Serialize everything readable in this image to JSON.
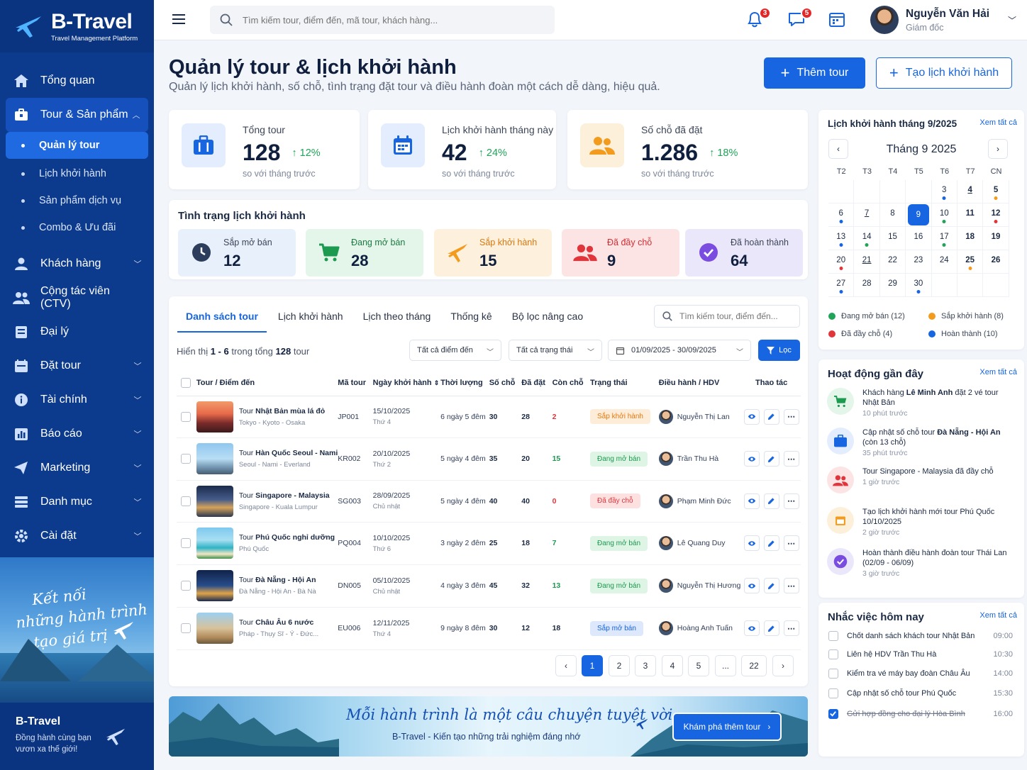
{
  "brand": {
    "name": "B-Travel",
    "tagline": "Travel Management Platform"
  },
  "sidebar": {
    "items": [
      {
        "label": "Tổng quan",
        "icon": "home-icon"
      },
      {
        "label": "Tour & Sản phẩm",
        "icon": "briefcase-icon"
      },
      {
        "label": "Khách hàng",
        "icon": "user-icon"
      },
      {
        "label": "Cộng tác viên (CTV)",
        "icon": "users-icon"
      },
      {
        "label": "Đại lý",
        "icon": "store-icon"
      },
      {
        "label": "Đặt tour",
        "icon": "calendar-icon"
      },
      {
        "label": "Tài chính",
        "icon": "finance-icon"
      },
      {
        "label": "Báo cáo",
        "icon": "report-icon"
      },
      {
        "label": "Marketing",
        "icon": "megaphone-icon"
      },
      {
        "label": "Danh mục",
        "icon": "list-icon"
      },
      {
        "label": "Cài đặt",
        "icon": "gear-icon"
      }
    ],
    "sub": [
      "Quản lý tour",
      "Lịch khởi hành",
      "Sản phẩm dịch vụ",
      "Combo & Ưu đãi"
    ],
    "promo_slogan": [
      "Kết nối",
      "những hành trình",
      "tạo giá trị"
    ],
    "footer_title": "B-Travel",
    "footer_sub": "Đồng hành cùng bạn vươn xa thế giới!"
  },
  "header": {
    "search_placeholder": "Tìm kiếm tour, điểm đến, mã tour, khách hàng...",
    "notif_count": "3",
    "msg_count": "5",
    "user_name": "Nguyễn Văn Hải",
    "user_role": "Giám đốc"
  },
  "page": {
    "title": "Quản lý tour & lịch khởi hành",
    "subtitle": "Quản lý lịch khởi hành, số chỗ, tình trạng đặt tour và điều hành đoàn một cách dễ dàng, hiệu quả.",
    "add_tour": "Thêm tour",
    "add_schedule": "Tạo lịch khởi hành"
  },
  "stats": [
    {
      "label": "Tổng tour",
      "value": "128",
      "trend": "12%",
      "caption": "so với tháng trước"
    },
    {
      "label": "Lịch khởi hành tháng này",
      "value": "42",
      "trend": "24%",
      "caption": "so với tháng trước"
    },
    {
      "label": "Số chỗ đã đặt",
      "value": "1.286",
      "trend": "18%",
      "caption": "so với tháng trước"
    }
  ],
  "status": {
    "title": "Tình trạng lịch khởi hành",
    "items": [
      {
        "label": "Sắp mở bán",
        "value": "12"
      },
      {
        "label": "Đang mở bán",
        "value": "28"
      },
      {
        "label": "Sắp khởi hành",
        "value": "15"
      },
      {
        "label": "Đã đầy chỗ",
        "value": "9"
      },
      {
        "label": "Đã hoàn thành",
        "value": "64"
      }
    ]
  },
  "table": {
    "tabs": [
      "Danh sách tour",
      "Lịch khởi hành",
      "Lịch theo tháng",
      "Thống kê",
      "Bộ lọc nâng cao"
    ],
    "search_placeholder": "Tìm kiếm tour, điểm đến...",
    "count_pre": "Hiển thị",
    "count_range": "1 - 6",
    "count_mid": "trong tổng",
    "count_total": "128",
    "count_post": "tour",
    "filter_dest": "Tất cả điểm đến",
    "filter_status": "Tất cả trạng thái",
    "filter_date": "01/09/2025 - 30/09/2025",
    "filter_btn": "Lọc",
    "columns": [
      "Tour / Điểm đến",
      "Mã tour",
      "Ngày khởi hành",
      "Thời lượng",
      "Số chỗ",
      "Đã đặt",
      "Còn chỗ",
      "Trạng thái",
      "Điều hành / HDV",
      "Thao tác"
    ],
    "rows": [
      {
        "pre": "Tour ",
        "name": "Nhật Bản mùa lá đỏ",
        "route": "Tokyo - Kyoto - Osaka",
        "code": "JP001",
        "date": "15/10/2025",
        "day": "Thứ 4",
        "dur": "6 ngày 5 đêm",
        "seats": "30",
        "booked": "28",
        "left": "2",
        "status": "Sắp khởi hành",
        "guide": "Nguyễn Thị Lan"
      },
      {
        "pre": "Tour ",
        "name": "Hàn Quốc Seoul - Nami",
        "route": "Seoul - Nami - Everland",
        "code": "KR002",
        "date": "20/10/2025",
        "day": "Thứ 2",
        "dur": "5 ngày 4 đêm",
        "seats": "35",
        "booked": "20",
        "left": "15",
        "status": "Đang mở bán",
        "guide": "Trần Thu Hà"
      },
      {
        "pre": "Tour ",
        "name": "Singapore - Malaysia",
        "route": "Singapore - Kuala Lumpur",
        "code": "SG003",
        "date": "28/09/2025",
        "day": "Chủ nhật",
        "dur": "5 ngày 4 đêm",
        "seats": "40",
        "booked": "40",
        "left": "0",
        "status": "Đã đầy chỗ",
        "guide": "Phạm Minh Đức"
      },
      {
        "pre": "Tour ",
        "name": "Phú Quốc nghỉ dưỡng",
        "route": "Phú Quốc",
        "code": "PQ004",
        "date": "10/10/2025",
        "day": "Thứ 6",
        "dur": "3 ngày 2 đêm",
        "seats": "25",
        "booked": "18",
        "left": "7",
        "status": "Đang mở bán",
        "guide": "Lê Quang Duy"
      },
      {
        "pre": "Tour ",
        "name": "Đà Nẵng - Hội An",
        "route": "Đà Nẵng - Hội An - Bà Nà",
        "code": "DN005",
        "date": "05/10/2025",
        "day": "Chủ nhật",
        "dur": "4 ngày 3 đêm",
        "seats": "45",
        "booked": "32",
        "left": "13",
        "status": "Đang mở bán",
        "guide": "Nguyễn Thị Hương"
      },
      {
        "pre": "Tour ",
        "name": "Châu Âu 6 nước",
        "route": "Pháp - Thụy Sĩ - Ý - Đức...",
        "code": "EU006",
        "date": "12/11/2025",
        "day": "Thứ 4",
        "dur": "9 ngày 8 đêm",
        "seats": "30",
        "booked": "12",
        "left": "18",
        "status": "Sắp mở bán",
        "guide": "Hoàng Anh Tuấn"
      }
    ],
    "pages": [
      "1",
      "2",
      "3",
      "4",
      "5",
      "...",
      "22"
    ]
  },
  "banner": {
    "title": "Mỗi hành trình là một câu chuyện tuyệt vời",
    "subtitle": "B-Travel - Kiến tạo những trải nghiệm đáng nhớ",
    "button": "Khám phá thêm tour"
  },
  "calendar": {
    "title": "Lịch khởi hành tháng 9/2025",
    "view_all": "Xem tất cả",
    "month": "Tháng 9 2025",
    "weekdays": [
      "T2",
      "T3",
      "T4",
      "T5",
      "T6",
      "T7",
      "CN"
    ],
    "today": "9",
    "legend": [
      "Đang mở bán (12)",
      "Sắp khởi hành (8)",
      "Đã đầy chỗ (4)",
      "Hoàn thành (10)"
    ]
  },
  "activity": {
    "title": "Hoạt động gần đây",
    "view_all": "Xem tất cả",
    "items": [
      {
        "text": "Khách hàng ",
        "bold": "Lê Minh Anh",
        "text2": " đặt 2 vé tour Nhật Bản",
        "time": "10 phút trước"
      },
      {
        "text": "Cập nhật số chỗ tour ",
        "bold": "Đà Nẵng - Hội An",
        "text2": " (còn 13 chỗ)",
        "time": "35 phút trước"
      },
      {
        "text": "Tour Singapore - Malaysia",
        "bold": "",
        "text2": " đã đầy chỗ",
        "time": "1 giờ trước"
      },
      {
        "text": "Tạo lịch khởi hành mới",
        "bold": "",
        "text2": " tour Phú Quốc 10/10/2025",
        "time": "2 giờ trước"
      },
      {
        "text": "Hoàn thành điều hành đoàn",
        "bold": "",
        "text2": " tour Thái Lan (02/09 - 06/09)",
        "time": "3 giờ trước"
      }
    ]
  },
  "todo": {
    "title": "Nhắc việc hôm nay",
    "view_all": "Xem tất cả",
    "items": [
      {
        "text": "Chốt danh sách khách tour Nhật Bản",
        "time": "09:00",
        "done": false
      },
      {
        "text": "Liên hệ HDV Trần Thu Hà",
        "time": "10:30",
        "done": false
      },
      {
        "text": "Kiểm tra vé máy bay đoàn Châu Âu",
        "time": "14:00",
        "done": false
      },
      {
        "text": "Cập nhật số chỗ tour Phú Quốc",
        "time": "15:30",
        "done": false
      },
      {
        "text": "Gửi hợp đồng cho đại lý Hòa Bình",
        "time": "16:00",
        "done": true
      }
    ]
  },
  "colors": {
    "primary": "#1765e0",
    "sidebar": "#0c3a8c",
    "green": "#21a358",
    "orange": "#f29b1d",
    "red": "#e0353a"
  }
}
